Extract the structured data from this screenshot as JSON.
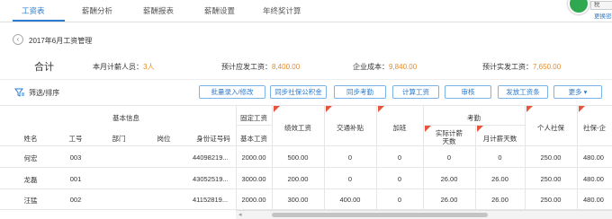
{
  "nav": {
    "tabs": [
      "工资表",
      "薪酬分析",
      "薪酬报表",
      "薪酬设置",
      "年终奖计算"
    ],
    "user_tag": "税",
    "user_link": "更换密码"
  },
  "breadcrumb": {
    "icon": "‹",
    "title": "2017年6月工资管理"
  },
  "summary": {
    "total_label": "合计",
    "people_label": "本月计薪人员：",
    "people_value": "3人",
    "payable_label": "预计应发工资：",
    "payable_value": "8,400.00",
    "cost_label": "企业成本：",
    "cost_value": "9,840.00",
    "actual_label": "预计实发工资：",
    "actual_value": "7,650.00"
  },
  "toolbar": {
    "filter_label": "筛选/排序",
    "buttons": [
      "批量录入/修改",
      "同步社保公积金",
      "同步考勤",
      "计算工资",
      "审核",
      "发放工资条",
      "更多 ▾"
    ]
  },
  "table": {
    "group_basic": "基本信息",
    "group_fixed": "固定工资",
    "group_attendance": "考勤",
    "headers": {
      "name": "姓名",
      "id": "工号",
      "dept": "部门",
      "position": "岗位",
      "idcard": "身份证号码",
      "base": "基本工资",
      "perf": "绩效工资",
      "traffic": "交通补贴",
      "overtime": "加班",
      "actual_days": "实际计薪天数",
      "month_days": "月计薪天数",
      "personal_ss": "个人社保",
      "company_ss": "社保-企"
    },
    "rows": [
      {
        "name": "何宏",
        "id": "003",
        "dept": "",
        "position": "",
        "idcard": "44098219...",
        "base": "2000.00",
        "perf": "500.00",
        "traffic": "0",
        "overtime": "0",
        "actual_days": "0",
        "month_days": "0",
        "personal_ss": "250.00",
        "company_ss": "480.00"
      },
      {
        "name": "龙磊",
        "id": "001",
        "dept": "",
        "position": "",
        "idcard": "43052519...",
        "base": "3000.00",
        "perf": "200.00",
        "traffic": "0",
        "overtime": "0",
        "actual_days": "26.00",
        "month_days": "26.00",
        "personal_ss": "250.00",
        "company_ss": "480.00"
      },
      {
        "name": "汪猛",
        "id": "002",
        "dept": "",
        "position": "",
        "idcard": "41152819...",
        "base": "2000.00",
        "perf": "300.00",
        "traffic": "400.00",
        "overtime": "0",
        "actual_days": "26.00",
        "month_days": "26.00",
        "personal_ss": "250.00",
        "company_ss": "480.00"
      }
    ]
  },
  "scrollbar": {
    "arrow": "◂"
  },
  "colors": {
    "accent": "#2a7bd1",
    "value": "#e98b2a",
    "corner": "#e8553f"
  }
}
